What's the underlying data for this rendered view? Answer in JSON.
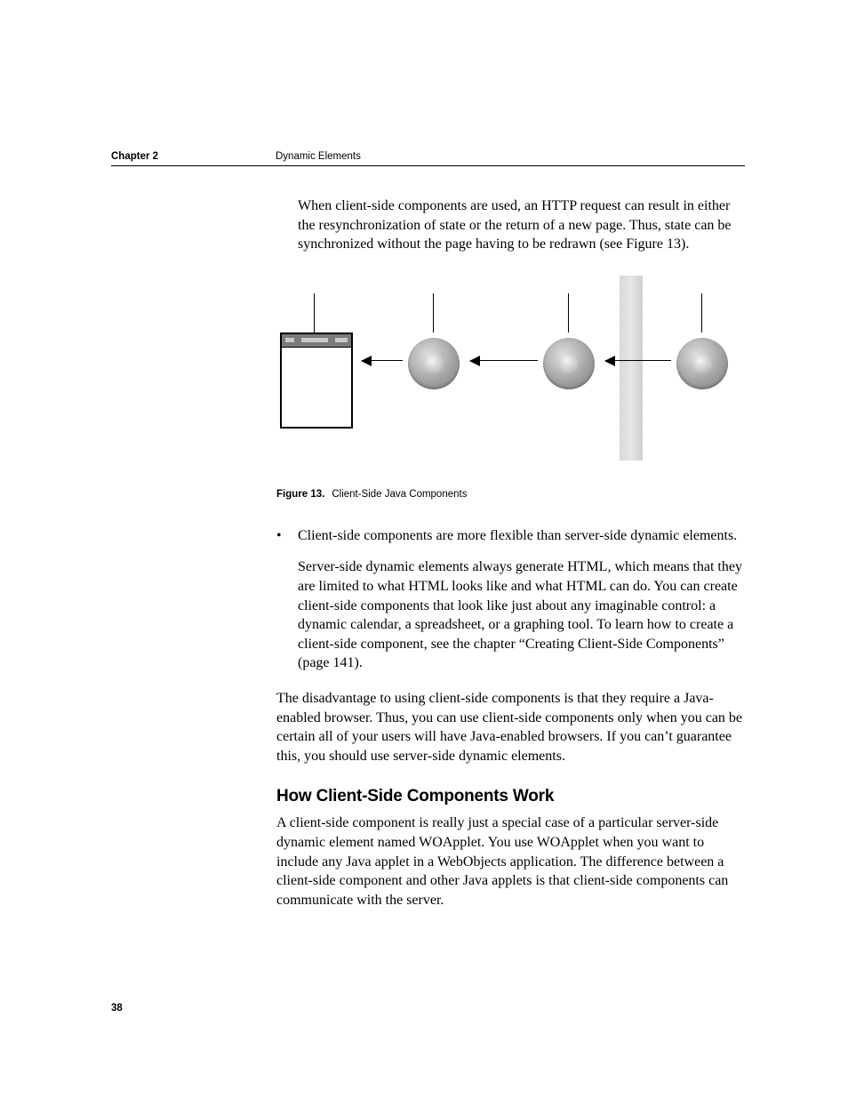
{
  "header": {
    "chapter": "Chapter 2",
    "title": "Dynamic Elements"
  },
  "para1": "When client-side components are used, an HTTP request can result in either the resynchronization of state or the return of a new page. Thus, state can be synchronized without the page having to be redrawn (see Figure 13).",
  "figure": {
    "label": "Figure 13.",
    "caption": "Client-Side Java Components"
  },
  "bullet1": "Client-side components are more flexible than server-side dynamic elements.",
  "bullet1_detail": "Server-side dynamic elements always generate HTML, which means that they are limited to what HTML looks like and what HTML can do. You can create client-side components that look like just about any imaginable control: a dynamic calendar, a spreadsheet, or a graphing tool. To learn how to create a client-side component, see the chapter “Creating Client-Side Components” (page 141).",
  "para2": "The disadvantage to using client-side components is that they require a Java-enabled browser. Thus, you can use client-side components only when you can be certain all of your users will have Java-enabled browsers. If you can’t guarantee this, you should use server-side dynamic elements.",
  "subhead": "How Client-Side Components Work",
  "para3": "A client-side component is really just a special case of a particular server-side dynamic element named WOApplet. You use WOApplet when you want to include any Java applet in a WebObjects application. The difference between a client-side component and other Java applets is that client-side components can communicate with the server.",
  "pagenum": "38"
}
